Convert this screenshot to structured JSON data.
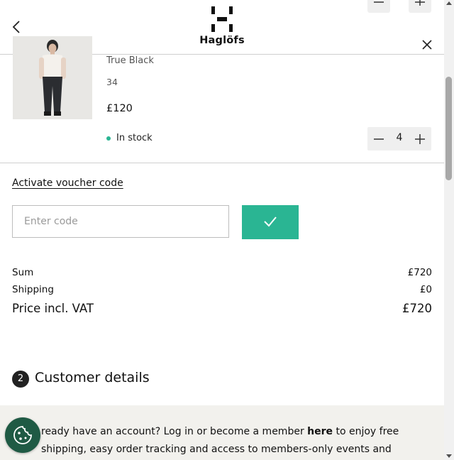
{
  "header": {
    "brand": "Haglöfs"
  },
  "cart_item": {
    "color": "True Black",
    "size": "34",
    "price": "£120",
    "stock": "In stock",
    "quantity": "4"
  },
  "voucher": {
    "link_label": "Activate voucher code",
    "placeholder": "Enter code"
  },
  "totals": {
    "sum_label": "Sum",
    "sum_value": "£720",
    "shipping_label": "Shipping",
    "shipping_value": "£0",
    "total_label": "Price incl. VAT",
    "total_value": "£720"
  },
  "customer": {
    "step_number": "2",
    "title": "Customer details",
    "info_prefix": "ready have an account? Log in or become a member ",
    "info_link": "here",
    "info_suffix": " to enjoy free shipping, easy order tracking and access to members-only events and"
  },
  "colors": {
    "accent": "#2ab593",
    "cookie_button": "#1f5a44"
  },
  "icons": [
    "back-arrow-icon",
    "brand-logo-icon",
    "close-icon",
    "minus-icon",
    "plus-icon",
    "checkmark-icon",
    "cookie-icon"
  ]
}
